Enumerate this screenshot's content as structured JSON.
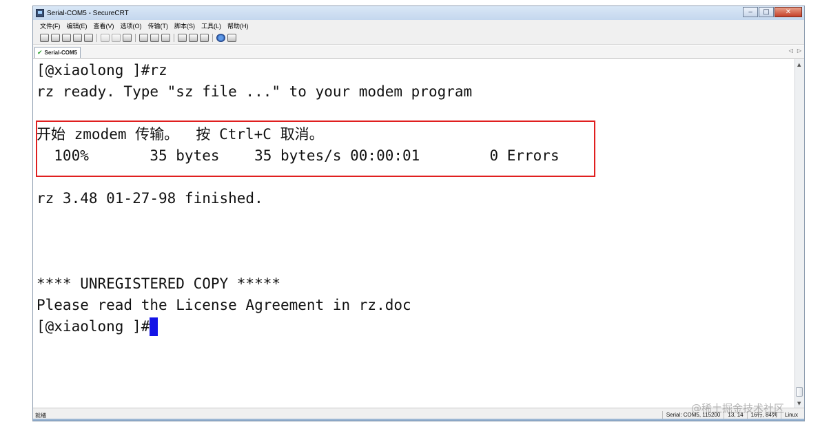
{
  "window": {
    "title": "Serial-COM5 - SecureCRT",
    "controls": {
      "minimize": "‒",
      "maximize": "□",
      "close": "✕"
    }
  },
  "menu": [
    "文件(F)",
    "编辑(E)",
    "查看(V)",
    "选项(O)",
    "传输(T)",
    "脚本(S)",
    "工具(L)",
    "帮助(H)"
  ],
  "tab": {
    "label": "Serial-COM5",
    "check_icon": "✔",
    "prev": "◁",
    "next": "▷"
  },
  "terminal": {
    "lines": [
      "[@xiaolong ]#rz",
      "rz ready. Type \"sz file ...\" to your modem program",
      "开始 zmodem 传输。  按 Ctrl+C 取消。",
      "  100%       35 bytes    35 bytes/s 00:00:01        0 Errors",
      "rz 3.48 01-27-98 finished.",
      "**** UNREGISTERED COPY *****",
      "Please read the License Agreement in rz.doc",
      "[@xiaolong ]#"
    ],
    "highlight_color": "#e01f1f",
    "cursor_color": "#1414e6"
  },
  "scrollbar": {
    "up": "▲",
    "down": "▼"
  },
  "status": {
    "ready": "就绪",
    "connection": "Serial: COM5, 115200",
    "cursor": "13, 14",
    "size": "16行, 84列",
    "terminal_type": "Linux"
  },
  "watermark": "@稀土掘金技术社区"
}
